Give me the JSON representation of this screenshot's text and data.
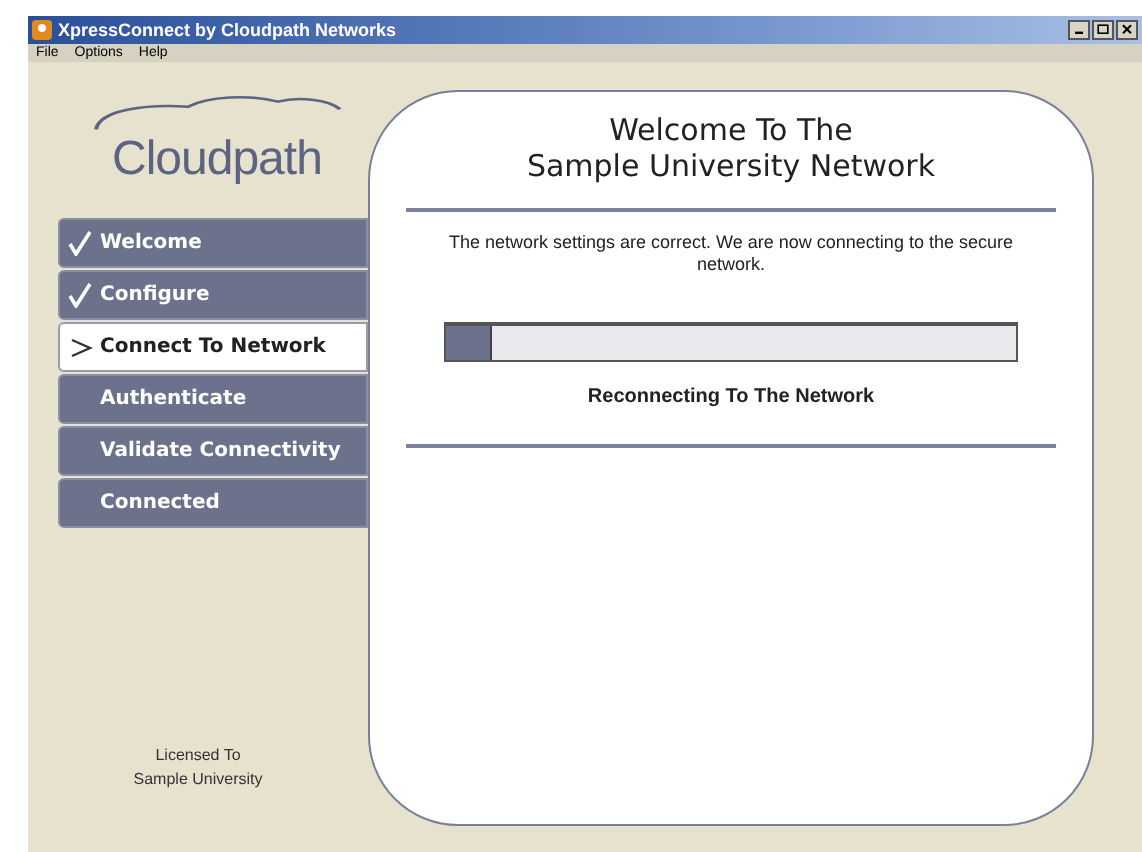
{
  "window": {
    "title": "XpressConnect by Cloudpath Networks"
  },
  "menu": [
    "File",
    "Options",
    "Help"
  ],
  "logo": {
    "text": "Cloudpath"
  },
  "steps": [
    {
      "label": "Welcome",
      "done": true,
      "selected": false
    },
    {
      "label": "Configure",
      "done": true,
      "selected": false
    },
    {
      "label": "Connect To Network",
      "done": false,
      "selected": true
    },
    {
      "label": "Authenticate",
      "done": false,
      "selected": false
    },
    {
      "label": "Validate Connectivity",
      "done": false,
      "selected": false
    },
    {
      "label": "Connected",
      "done": false,
      "selected": false
    }
  ],
  "license": [
    "Licensed To",
    "Sample University"
  ],
  "panel": {
    "title": [
      "Welcome To The",
      "Sample University Network"
    ],
    "message": "The network settings are correct.  We are now connecting to the secure network.",
    "progress": {
      "level": 0.08
    },
    "status": "Reconnecting To The Network"
  }
}
